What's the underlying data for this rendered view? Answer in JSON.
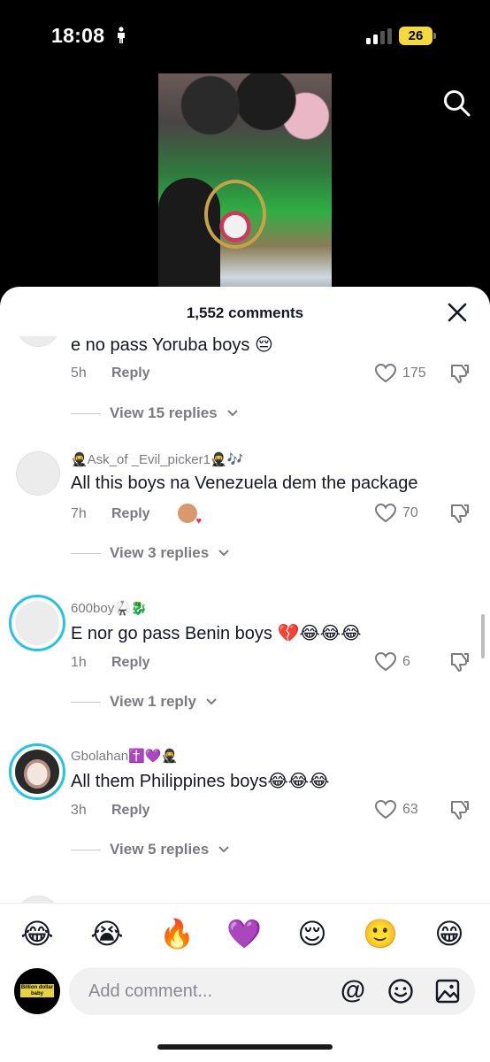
{
  "status_bar": {
    "time": "18:08",
    "battery": "26"
  },
  "sheet": {
    "title": "1,552 comments"
  },
  "comments": [
    {
      "username": "",
      "text": "e no pass Yoruba boys 😔",
      "age": "5h",
      "reply_label": "Reply",
      "likes": "175",
      "view_replies": "View 15 replies"
    },
    {
      "username": "🥷Ask_of _Evil_picker1🥷🎶",
      "text": "All this boys na Venezuela dem the package",
      "age": "7h",
      "reply_label": "Reply",
      "likes": "70",
      "view_replies": "View 3 replies"
    },
    {
      "username": "600boy🥋🐉",
      "text": "E nor go pass Benin boys 💔😂😂😂",
      "age": "1h",
      "reply_label": "Reply",
      "likes": "6",
      "view_replies": "View 1 reply"
    },
    {
      "username": "Gbolahan✝️💜🥷",
      "text": "All them Philippines boys😂😂😂",
      "age": "3h",
      "reply_label": "Reply",
      "likes": "63",
      "view_replies": "View 5 replies"
    }
  ],
  "quick_emojis": [
    "😂",
    "😭",
    "🔥",
    "💜",
    "😌",
    "🙂",
    "😁"
  ],
  "composer": {
    "placeholder": "Add comment...",
    "avatar_text": "Billion dollar baby"
  },
  "icons": {
    "search": "search-icon",
    "close": "close-icon",
    "like": "heart-outline-icon",
    "dislike": "thumbs-down-icon",
    "mention": "at-icon",
    "emoji": "smiley-icon",
    "image": "image-icon"
  }
}
